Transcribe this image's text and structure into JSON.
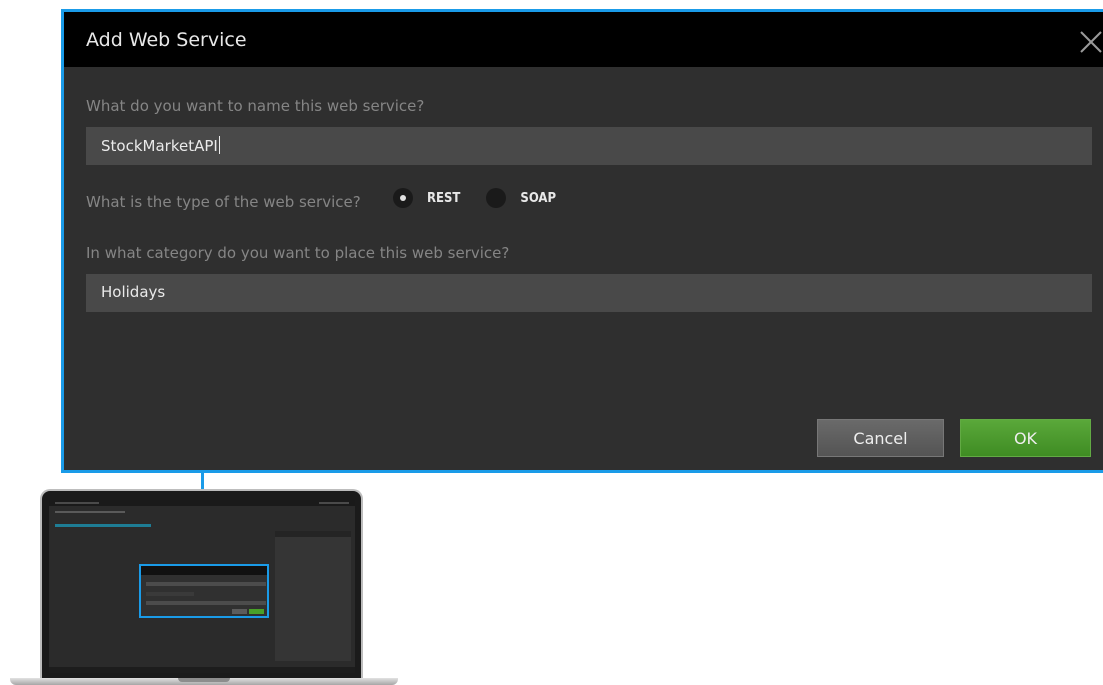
{
  "dialog": {
    "title": "Add Web Service",
    "name_prompt": "What do you want to name this web service?",
    "name_value": "StockMarketAPI",
    "type_prompt": "What is the type of the web service?",
    "type_options": [
      {
        "label": "REST",
        "selected": true
      },
      {
        "label": "SOAP",
        "selected": false
      }
    ],
    "category_prompt": "In what category do you want to place this web service?",
    "category_value": "Holidays",
    "cancel_label": "Cancel",
    "ok_label": "OK"
  },
  "icons": {
    "close": "close-icon",
    "radio_selected": "radio-selected-icon",
    "radio_unselected": "radio-unselected-icon"
  },
  "colors": {
    "highlight": "#1a9be8",
    "dialog_bg": "#2f2f2f",
    "titlebar_bg": "#000000",
    "field_bg": "#494949",
    "ok_button": "#4a9a2e",
    "cancel_button": "#5f5f5f"
  }
}
